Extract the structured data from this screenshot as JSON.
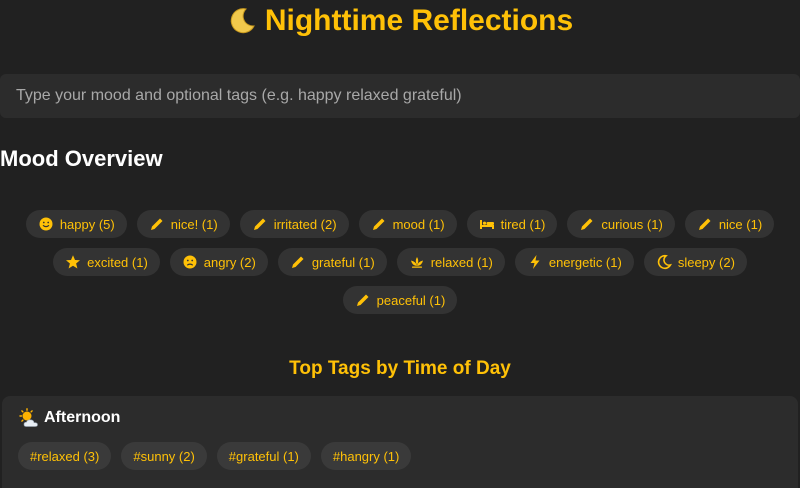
{
  "header": {
    "title": "Nighttime Reflections"
  },
  "mood_input": {
    "placeholder": "Type your mood and optional tags (e.g. happy relaxed grateful)",
    "value": ""
  },
  "overview": {
    "title": "Mood Overview",
    "rows": [
      [
        {
          "label": "happy (5)",
          "icon": "smile-icon"
        },
        {
          "label": "nice! (1)",
          "icon": "pencil-icon"
        },
        {
          "label": "irritated (2)",
          "icon": "pencil-icon"
        },
        {
          "label": "mood (1)",
          "icon": "pencil-icon"
        },
        {
          "label": "tired (1)",
          "icon": "bed-icon"
        },
        {
          "label": "curious (1)",
          "icon": "pencil-icon"
        },
        {
          "label": "nice (1)",
          "icon": "pencil-icon"
        }
      ],
      [
        {
          "label": "excited (1)",
          "icon": "star-icon"
        },
        {
          "label": "angry (2)",
          "icon": "frown-icon"
        },
        {
          "label": "grateful (1)",
          "icon": "pencil-icon"
        },
        {
          "label": "relaxed (1)",
          "icon": "lotus-icon"
        },
        {
          "label": "energetic (1)",
          "icon": "bolt-icon"
        },
        {
          "label": "sleepy (2)",
          "icon": "moon-icon"
        }
      ],
      [
        {
          "label": "peaceful (1)",
          "icon": "pencil-icon"
        }
      ]
    ]
  },
  "top_tags": {
    "title": "Top Tags by Time of Day",
    "periods": [
      {
        "name": "Afternoon",
        "icon": "sun-cloud-icon",
        "tags": [
          "#relaxed (3)",
          "#sunny (2)",
          "#grateful (1)",
          "#hangry (1)"
        ]
      }
    ]
  },
  "colors": {
    "background": "#212121",
    "accent": "#ffc107",
    "chip_bg": "#333333",
    "input_bg": "#2c2c2c"
  }
}
